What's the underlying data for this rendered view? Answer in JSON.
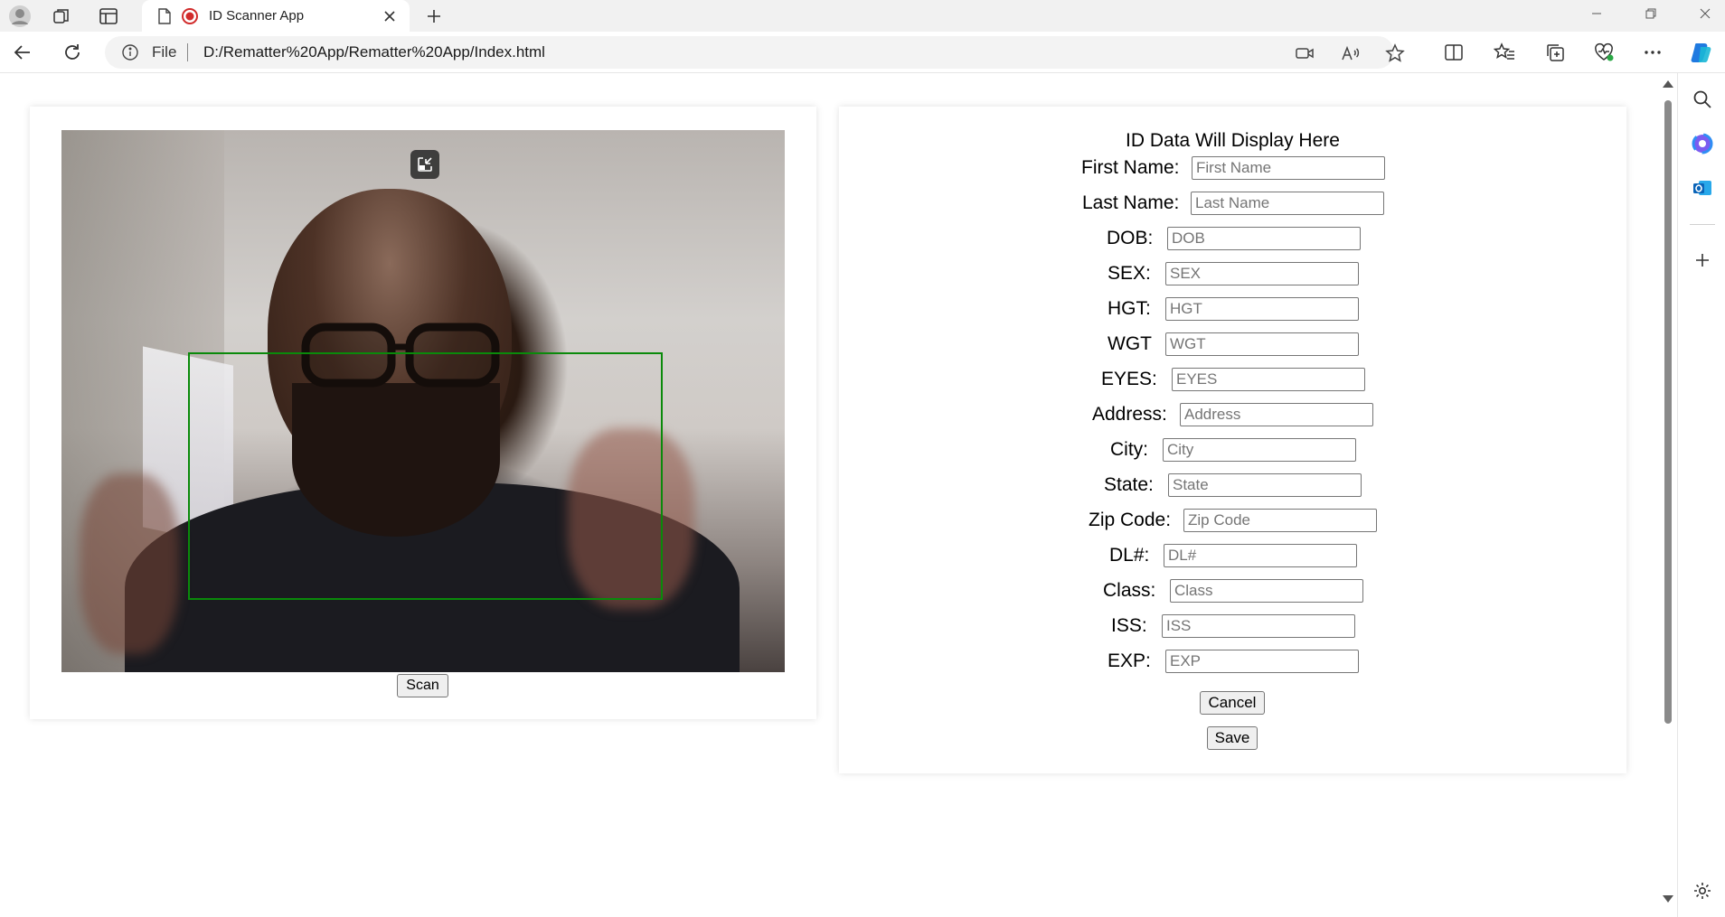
{
  "browser": {
    "tab_title": "ID Scanner App",
    "address_scheme_label": "File",
    "url": "D:/Rematter%20App/Rematter%20App/Index.html",
    "icons": {
      "profile": "profile-icon",
      "workspaces": "workspaces-icon",
      "vertical_tabs": "vertical-tabs-icon",
      "page": "page-icon",
      "recording": "recording-indicator-icon",
      "close_tab": "close-icon",
      "new_tab": "plus-icon",
      "back": "back-arrow-icon",
      "refresh": "refresh-icon",
      "info": "info-icon",
      "camera": "camera-icon",
      "read_aloud": "read-aloud-icon",
      "favorite": "star-icon",
      "split_screen": "split-screen-icon",
      "favorites": "favorites-icon",
      "collections": "collections-icon",
      "browser_essentials": "heart-pulse-icon",
      "more": "more-icon",
      "copilot": "copilot-icon",
      "search": "search-icon",
      "sidebar_app": "sidebar-app-icon",
      "outlook": "outlook-icon",
      "add": "plus-icon",
      "settings": "gear-icon"
    }
  },
  "scanner": {
    "scan_label": "Scan",
    "frame_color": "#0a8a0a"
  },
  "form": {
    "title": "ID Data Will Display Here",
    "fields": [
      {
        "label": "First Name:",
        "placeholder": "First Name",
        "value": ""
      },
      {
        "label": "Last Name:",
        "placeholder": "Last Name",
        "value": ""
      },
      {
        "label": "DOB:",
        "placeholder": "DOB",
        "value": ""
      },
      {
        "label": "SEX:",
        "placeholder": "SEX",
        "value": ""
      },
      {
        "label": "HGT:",
        "placeholder": "HGT",
        "value": ""
      },
      {
        "label": "WGT",
        "placeholder": "WGT",
        "value": ""
      },
      {
        "label": "EYES:",
        "placeholder": "EYES",
        "value": ""
      },
      {
        "label": "Address:",
        "placeholder": "Address",
        "value": ""
      },
      {
        "label": "City:",
        "placeholder": "City",
        "value": ""
      },
      {
        "label": "State:",
        "placeholder": "State",
        "value": ""
      },
      {
        "label": "Zip Code:",
        "placeholder": "Zip Code",
        "value": ""
      },
      {
        "label": "DL#:",
        "placeholder": "DL#",
        "value": ""
      },
      {
        "label": "Class:",
        "placeholder": "Class",
        "value": ""
      },
      {
        "label": "ISS:",
        "placeholder": "ISS",
        "value": ""
      },
      {
        "label": "EXP:",
        "placeholder": "EXP",
        "value": ""
      }
    ],
    "cancel_label": "Cancel",
    "save_label": "Save"
  }
}
